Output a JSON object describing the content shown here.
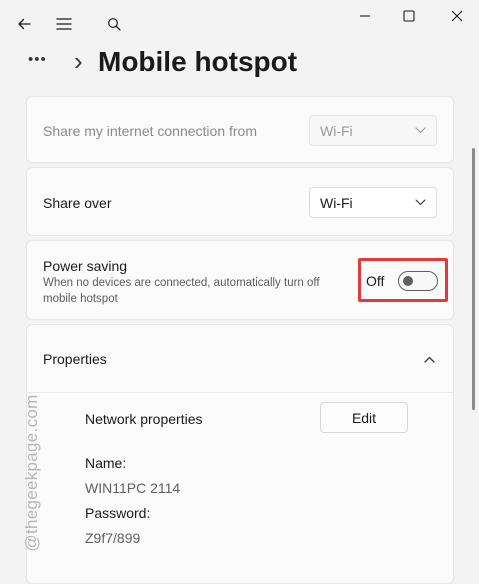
{
  "page": {
    "title": "Mobile hotspot",
    "more_glyph": "•••",
    "breadcrumb_chevron": "›"
  },
  "titlebar": {
    "back_icon": "←",
    "menu_icon": "≡",
    "search_icon": "search",
    "minimize_icon": "—",
    "maximize_icon": "□",
    "close_icon": "✕"
  },
  "share_from": {
    "label": "Share my internet connection from",
    "value": "Wi-Fi",
    "enabled": false
  },
  "share_over": {
    "label": "Share over",
    "value": "Wi-Fi"
  },
  "power_saving": {
    "title": "Power saving",
    "description": "When no devices are connected, automatically turn off mobile hotspot",
    "state_label": "Off",
    "on": false,
    "highlight_color": "#e03a3a"
  },
  "properties": {
    "title": "Properties",
    "network_properties_label": "Network properties",
    "edit_button": "Edit",
    "name_label": "Name:",
    "name_value": "WIN11PC 2114",
    "password_label": "Password:",
    "password_value": "Z9f7/899"
  },
  "watermark": "@thegeekpage.com"
}
